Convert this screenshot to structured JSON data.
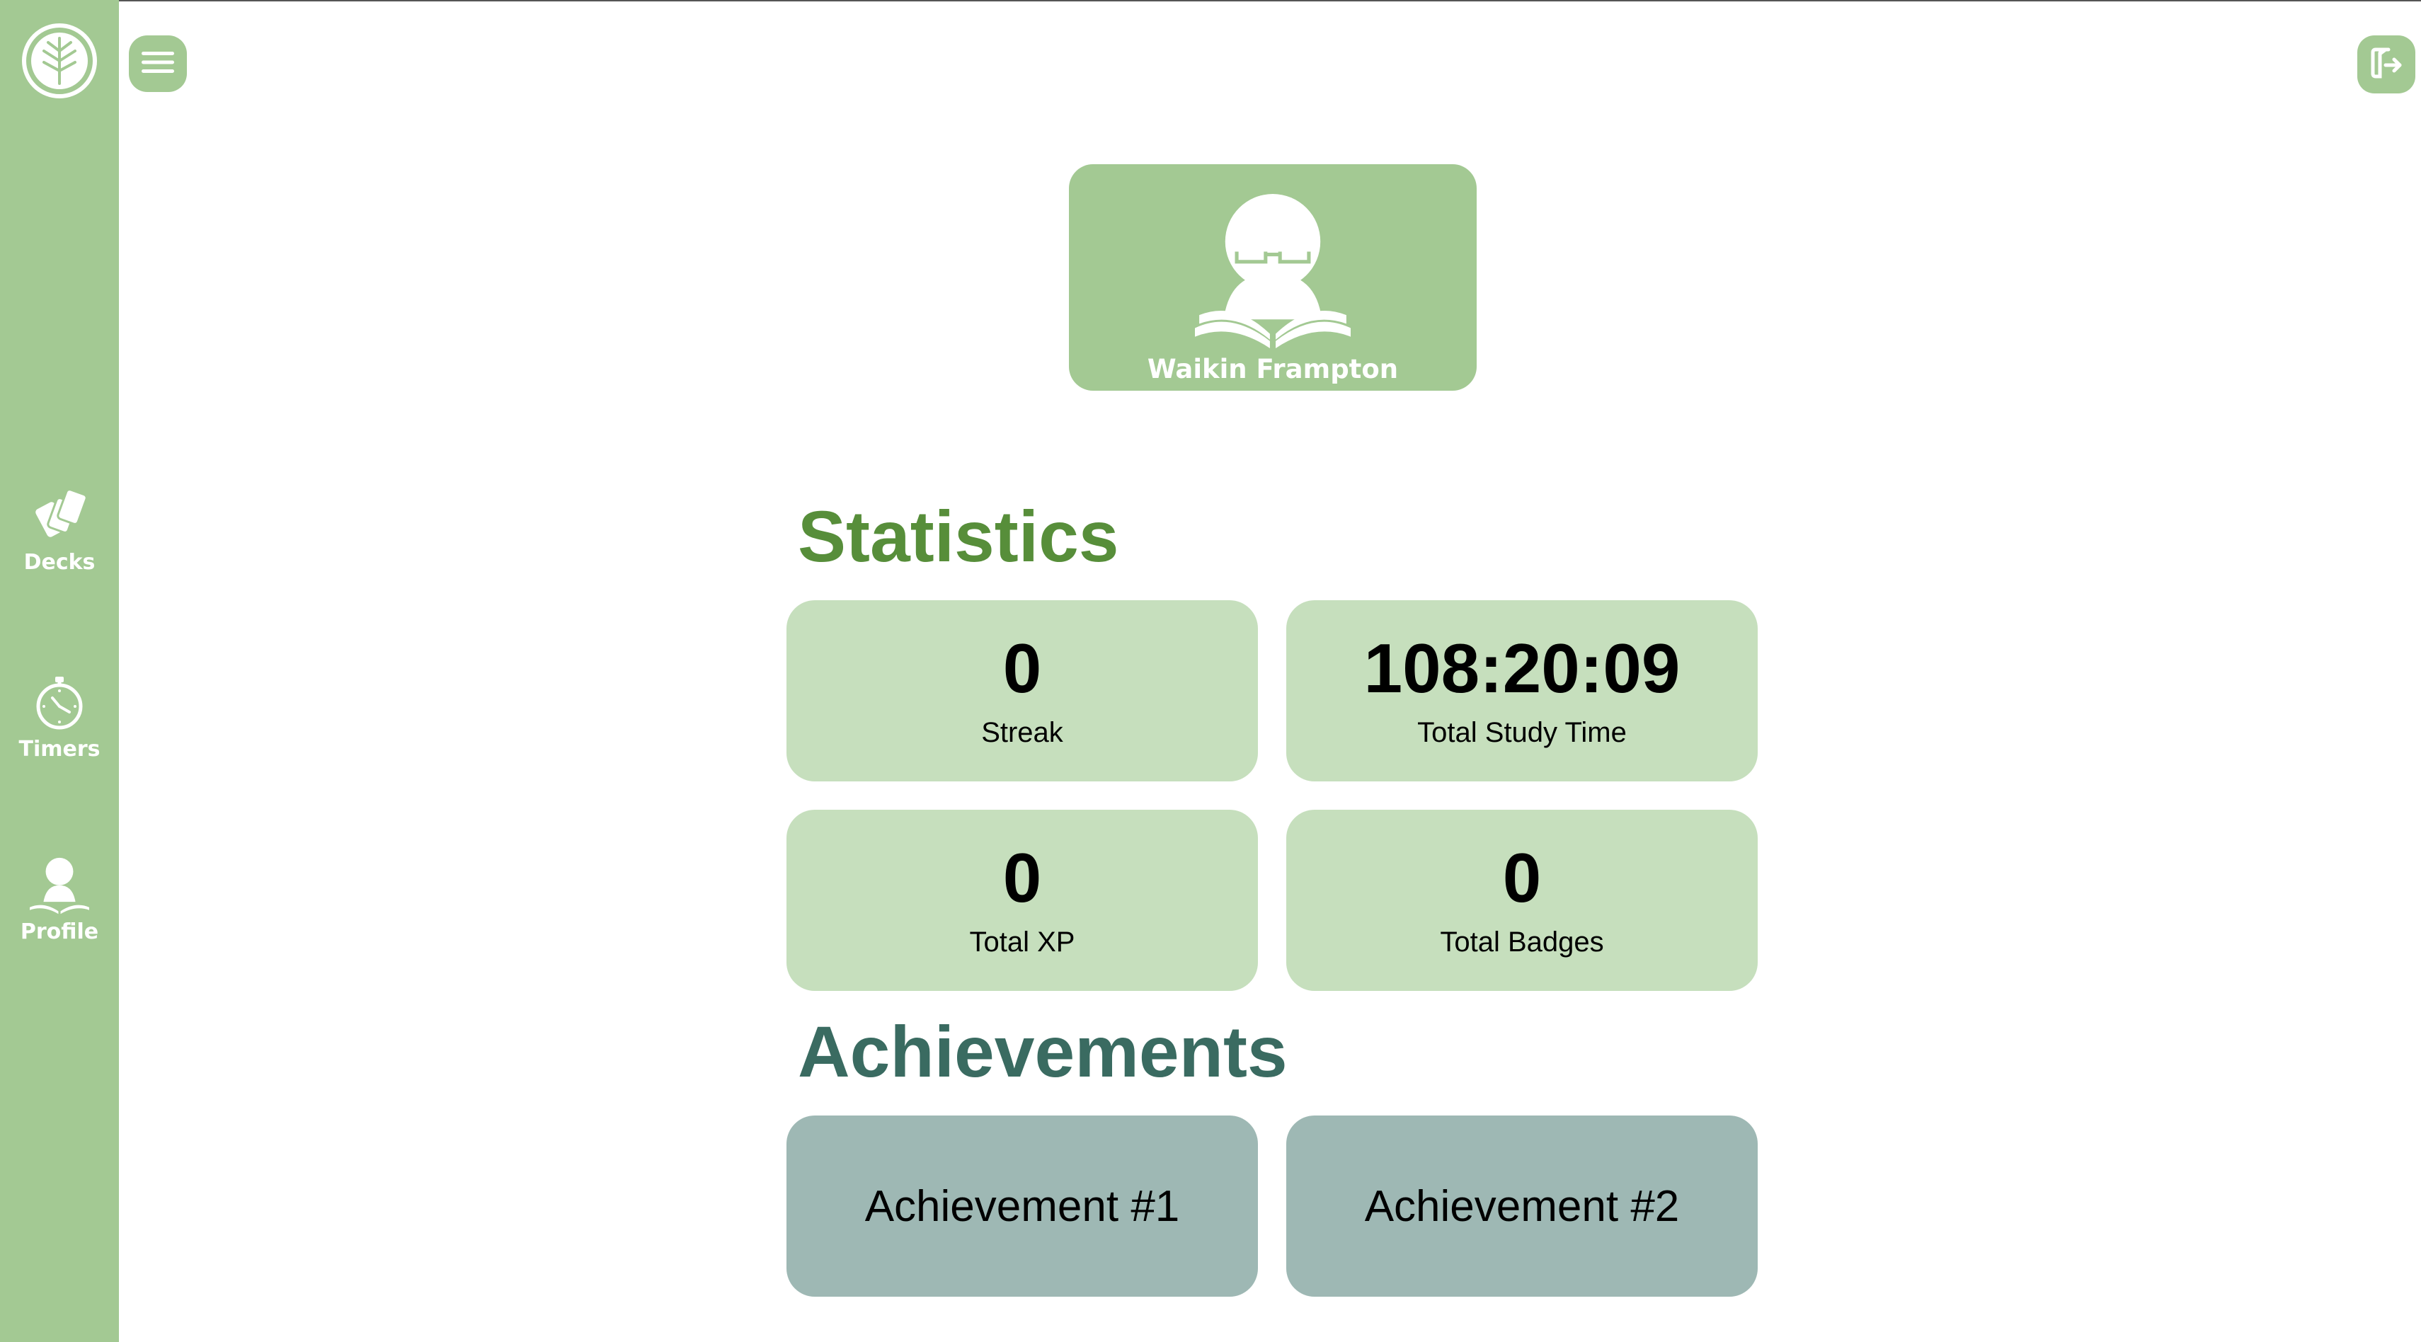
{
  "sidebar": {
    "logo_icon": "tree-circle-logo",
    "items": [
      {
        "label": "Decks",
        "icon": "cards-icon"
      },
      {
        "label": "Timers",
        "icon": "stopwatch-icon"
      },
      {
        "label": "Profile",
        "icon": "reader-icon"
      }
    ]
  },
  "header": {
    "menu_icon": "hamburger-menu-icon",
    "logout_icon": "logout-icon"
  },
  "profile": {
    "name": "Waikin Frampton",
    "avatar_icon": "reader-avatar-icon"
  },
  "statistics": {
    "title": "Statistics",
    "cards": [
      {
        "value": "0",
        "label": "Streak"
      },
      {
        "value": "108:20:09",
        "label": "Total Study Time"
      },
      {
        "value": "0",
        "label": "Total XP"
      },
      {
        "value": "0",
        "label": "Total Badges"
      }
    ]
  },
  "achievements": {
    "title": "Achievements",
    "items": [
      {
        "label": "Achievement #1"
      },
      {
        "label": "Achievement #2"
      }
    ]
  },
  "colors": {
    "sidebar": "#a3c993",
    "stat_card": "#c6dfbd",
    "achievement_card": "#9eb8b4",
    "statistics_title": "#578e3a",
    "achievements_title": "#3a6b61"
  }
}
